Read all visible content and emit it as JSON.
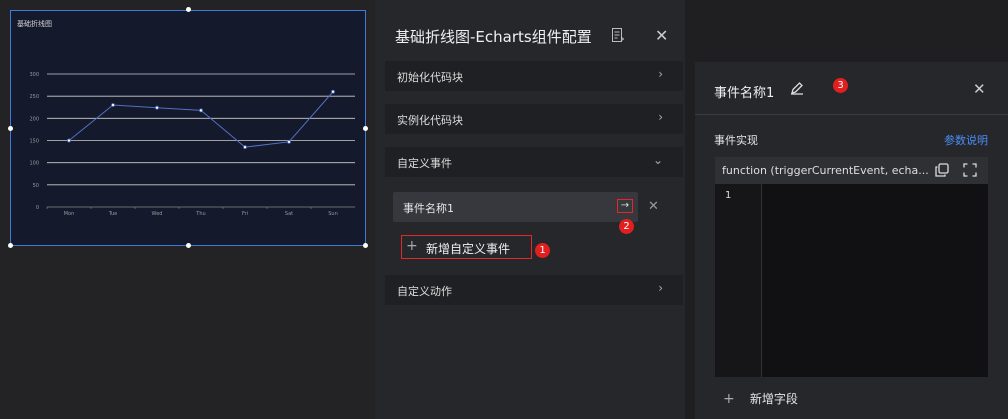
{
  "chart": {
    "title": "基础折线图"
  },
  "chart_data": {
    "type": "line",
    "categories": [
      "Mon",
      "Tue",
      "Wed",
      "Thu",
      "Fri",
      "Sat",
      "Sun"
    ],
    "series": [
      {
        "values": [
          150,
          230,
          224,
          218,
          135,
          147,
          260
        ]
      }
    ],
    "yticks": [
      "0",
      "50",
      "100",
      "150",
      "200",
      "250",
      "300"
    ],
    "ylim": [
      0,
      300
    ],
    "grid": true,
    "line_color": "#5470c6"
  },
  "config_panel": {
    "title": "基础折线图-Echarts组件配置",
    "sections": [
      {
        "label": "初始化代码块"
      },
      {
        "label": "实例化代码块"
      },
      {
        "label": "自定义事件"
      },
      {
        "label": "自定义动作"
      }
    ],
    "event_item": "事件名称1",
    "arrow_glyph": "→",
    "add_event": "新增自定义事件"
  },
  "event_panel": {
    "title": "事件名称1",
    "impl_label": "事件实现",
    "param_link": "参数说明",
    "signature": "function (triggerCurrentEvent, echa...",
    "line_number": "1",
    "add_field": "新增字段"
  },
  "badges": [
    "1",
    "2",
    "3"
  ],
  "colors": {
    "accent": "#4b8cf5",
    "highlight_border": "#e02a2a",
    "badge": "#e21f1f",
    "chart_border": "#3f7bd8"
  }
}
